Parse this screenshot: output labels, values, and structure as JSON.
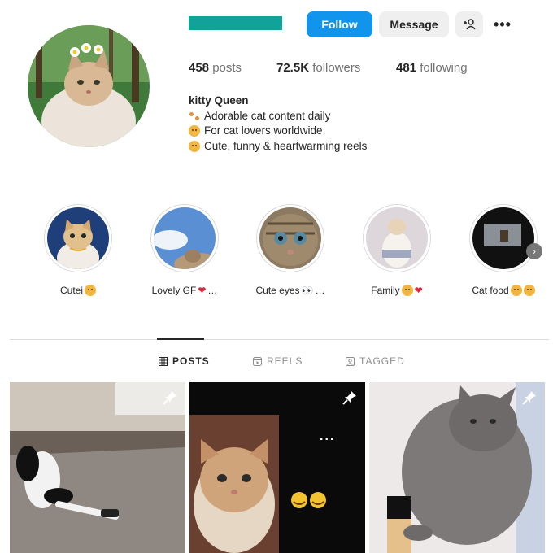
{
  "profile": {
    "follow_label": "Follow",
    "message_label": "Message",
    "add_user_icon": "add-user-icon",
    "more_label": "•••",
    "stats": {
      "posts_count": "458",
      "posts_label": "posts",
      "followers_count": "72.5K",
      "followers_label": "followers",
      "following_count": "481",
      "following_label": "following"
    },
    "bio": {
      "name": "kitty Queen",
      "lines": [
        "Adorable cat content daily",
        "For cat lovers worldwide",
        "Cute, funny & heartwarming reels"
      ]
    }
  },
  "highlights": [
    {
      "label": "Cutei",
      "emoji": ""
    },
    {
      "label": "Lovely GF",
      "emoji": "…"
    },
    {
      "label": "Cute eyes",
      "emoji": "…"
    },
    {
      "label": "Family",
      "emoji": ""
    },
    {
      "label": "Cat food",
      "emoji": ""
    }
  ],
  "tabs": [
    {
      "label": "POSTS",
      "active": true
    },
    {
      "label": "REELS",
      "active": false
    },
    {
      "label": "TAGGED",
      "active": false
    }
  ],
  "posts": [
    {
      "pinned": true
    },
    {
      "pinned": true,
      "overlay_text": "..."
    },
    {
      "pinned": true
    }
  ],
  "colors": {
    "accent": "#1195ec",
    "username_bar": "#11a39a",
    "heart": "#e0243b"
  }
}
